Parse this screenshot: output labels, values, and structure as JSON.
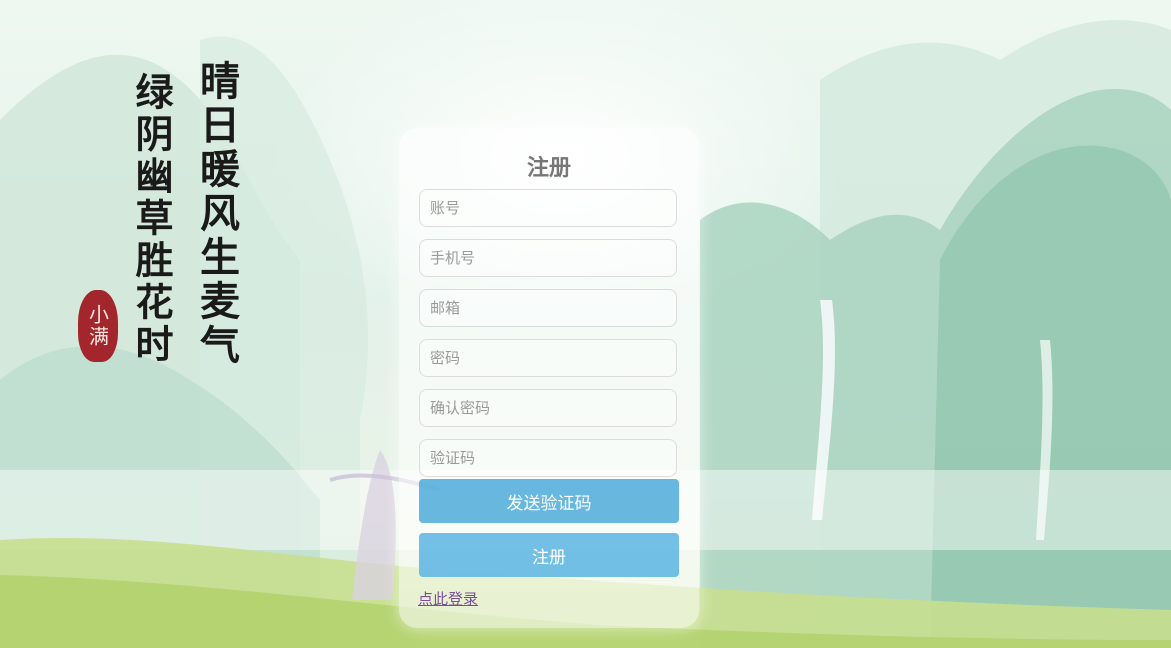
{
  "calligraphy": {
    "line_right": "晴日暖风生麦气",
    "line_left": "绿阴幽草胜花时",
    "seal": "小满"
  },
  "form": {
    "title": "注册",
    "fields": [
      {
        "placeholder": "账号",
        "value": ""
      },
      {
        "placeholder": "手机号",
        "value": ""
      },
      {
        "placeholder": "邮箱",
        "value": ""
      },
      {
        "placeholder": "密码",
        "value": ""
      },
      {
        "placeholder": "确认密码",
        "value": ""
      },
      {
        "placeholder": "验证码",
        "value": ""
      }
    ],
    "send_code_label": "发送验证码",
    "register_label": "注册",
    "login_link": "点此登录"
  },
  "colors": {
    "send_code_button": "#4eaadb",
    "register_button": "#60b6e4",
    "link": "#7a4f9a",
    "seal": "#a3262c"
  }
}
